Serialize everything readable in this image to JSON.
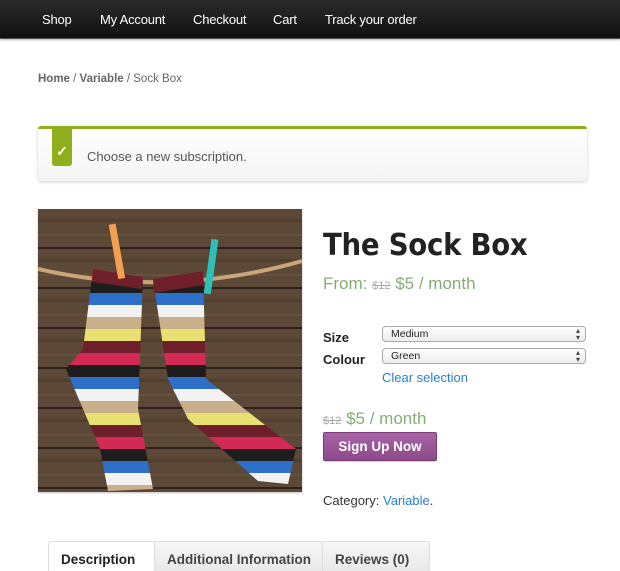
{
  "nav": {
    "items": [
      "Shop",
      "My Account",
      "Checkout",
      "Cart",
      "Track your order"
    ]
  },
  "breadcrumb": {
    "home": "Home",
    "category": "Variable",
    "separator": " / ",
    "current": "Sock Box"
  },
  "notice": {
    "icon": "checkmark-icon",
    "glyph": "✓",
    "message": "Choose a new subscription.",
    "accent_color": "#8fae1b"
  },
  "product": {
    "image_alt": "Striped socks hanging on a rope with clothespins",
    "title": "The Sock Box",
    "price_from_label": "From:",
    "old_price": "$12",
    "price": "$5 / month",
    "variations": [
      {
        "label": "Size",
        "value": "Medium"
      },
      {
        "label": "Colour",
        "value": "Green"
      }
    ],
    "clear_selection": "Clear selection",
    "variation_old_price": "$12",
    "variation_price": "$5 / month",
    "signup_button": "Sign Up Now",
    "category_label": "Category:",
    "category_value": "Variable",
    "category_suffix": "."
  },
  "tabs": [
    {
      "label": "Description",
      "active": true
    },
    {
      "label": "Additional Information",
      "active": false
    },
    {
      "label": "Reviews (0)",
      "active": false
    }
  ],
  "colors": {
    "price_green": "#85ad74",
    "link_blue": "#2a7fd4",
    "button_purple": "#a964a7"
  }
}
